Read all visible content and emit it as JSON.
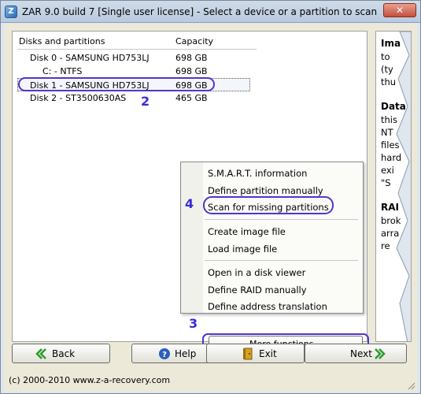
{
  "window": {
    "title": "ZAR 9.0 build 7 [Single user license] - Select a device or a partition to scan",
    "close_label": "✕"
  },
  "disk_list": {
    "headers": {
      "name": "Disks and partitions",
      "capacity": "Capacity"
    },
    "rows": [
      {
        "name": "Disk 0 - SAMSUNG HD753LJ",
        "capacity": "698 GB"
      },
      {
        "name": "C: - NTFS",
        "capacity": "698 GB"
      },
      {
        "name": "Disk 1 - SAMSUNG HD753LJ",
        "capacity": "698 GB"
      },
      {
        "name": "Disk 2 - ST3500630AS",
        "capacity": "465 GB"
      }
    ]
  },
  "context_menu": {
    "items": [
      "S.M.A.R.T. information",
      "Define partition manually",
      "Scan for missing partitions",
      "Create image file",
      "Load image file",
      "Open in a disk viewer",
      "Define RAID manually",
      "Define address translation"
    ]
  },
  "annotations": {
    "disk": "2",
    "more": "3",
    "scan": "4"
  },
  "more_functions_label": "More functions...",
  "help_panel": {
    "lines": [
      "Ima",
      "to",
      "(ty",
      "thu",
      "Data",
      "this",
      "NT",
      "files",
      "hard",
      "exi",
      "\"S",
      "RAI",
      "brok",
      "arra",
      "re"
    ]
  },
  "buttons": {
    "back": "Back",
    "help": "Help",
    "exit": "Exit",
    "next": "Next"
  },
  "footer": "(c) 2000-2010 www.z-a-recovery.com",
  "colors": {
    "annotation": "#3a2ad8",
    "titlebar": "#b9cade",
    "face": "#ece9d8"
  }
}
